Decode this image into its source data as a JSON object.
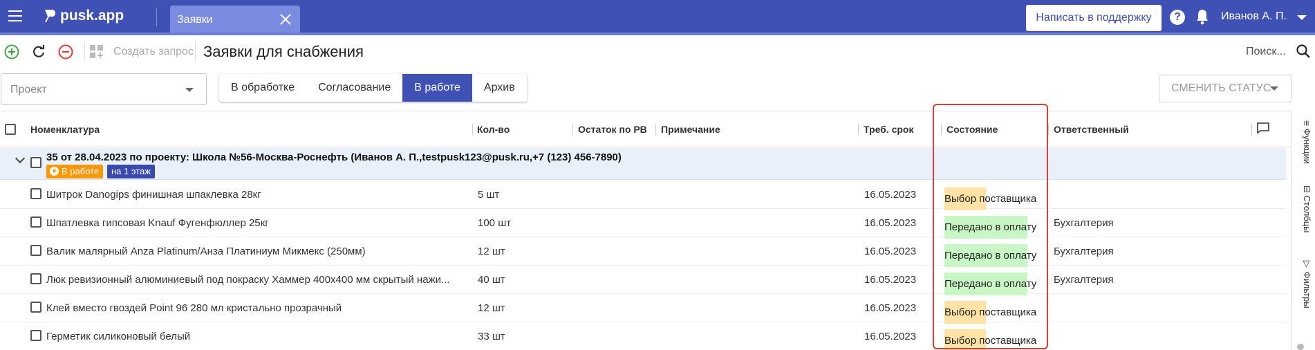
{
  "app": {
    "logo": "pusk.app",
    "tab_label": "Заявки",
    "support_label": "Написать в поддержку",
    "user_name": "Иванов А. П.",
    "accent": "#3f51b5"
  },
  "toolbar": {
    "create_request": "Создать запрос",
    "title": "Заявки для снабжения",
    "search_placeholder": "Поиск..."
  },
  "filters": {
    "project_placeholder": "Проект",
    "tabs": [
      "В обработке",
      "Согласование",
      "В работе",
      "Архив"
    ],
    "active_tab": "В работе",
    "status_button": "СМЕНИТЬ СТАТУС"
  },
  "table": {
    "columns": {
      "nomenclature": "Номенклатура",
      "qty": "Кол-во",
      "rest": "Остаток по РВ",
      "note": "Примечание",
      "deadline": "Треб. срок",
      "state": "Состояние",
      "responsible": "Ответственный"
    },
    "group": {
      "title": "35 от 28.04.2023 по проекту: Школа №56-Москва-Роснефть (Иванов А. П.,testpusk123@pusk.ru,+7 (123) 456-7890)",
      "status_badge": "В работе",
      "location_badge": "на 1 этаж"
    },
    "rows": [
      {
        "name": "Шитрок Danogips финишная шпаклевка 28кг",
        "qty": "5 шт",
        "deadline": "16.05.2023",
        "state": "Выбор поставщика",
        "state_color": "#ffe2a6",
        "responsible": ""
      },
      {
        "name": "Шпатлевка гипсовая Knauf Фугенфюллер 25кг",
        "qty": "100 шт",
        "deadline": "16.05.2023",
        "state": "Передано в оплату",
        "state_color": "#c8f7c5",
        "responsible": "Бухгалтерия"
      },
      {
        "name": "Валик малярный Anza Platinum/Анза Платиниум Микмекс (250мм)",
        "qty": "12 шт",
        "deadline": "16.05.2023",
        "state": "Передано в оплату",
        "state_color": "#c8f7c5",
        "responsible": "Бухгалтерия"
      },
      {
        "name": "Люк ревизионный алюминиевый под покраску Хаммер 400х400 мм скрытый нажи...",
        "qty": "40 шт",
        "deadline": "16.05.2023",
        "state": "Передано в оплату",
        "state_color": "#c8f7c5",
        "responsible": "Бухгалтерия"
      },
      {
        "name": "Клей вместо гвоздей Point 96 280 мл кристально прозрачный",
        "qty": "12 шт",
        "deadline": "16.05.2023",
        "state": "Выбор поставщика",
        "state_color": "#ffe2a6",
        "responsible": ""
      },
      {
        "name": "Герметик силиконовый белый",
        "qty": "33 шт",
        "deadline": "16.05.2023",
        "state": "Выбор поставщика",
        "state_color": "#ffe2a6",
        "responsible": ""
      }
    ]
  },
  "side_panel": {
    "functions": "Функции",
    "columns": "Столбцы",
    "filters": "Фильтры"
  }
}
